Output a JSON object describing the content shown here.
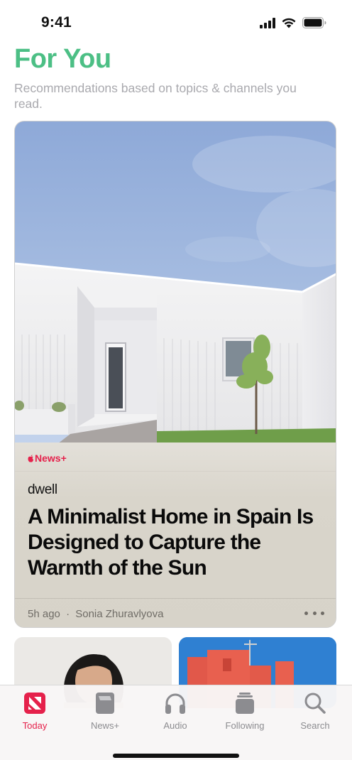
{
  "status_bar": {
    "time": "9:41",
    "icons": [
      "cellular-signal-icon",
      "wifi-icon",
      "battery-icon"
    ]
  },
  "header": {
    "title": "For You",
    "subtitle": "Recommendations based on topics & channels you read."
  },
  "feature": {
    "badge": "News+",
    "publisher": "dwell",
    "headline": "A Minimalist Home in Spain Is Designed to Capture the Warmth of the Sun",
    "time_ago": "5h ago",
    "separator": "·",
    "author": "Sonia Zhuravlyova"
  },
  "tabs": [
    {
      "label": "Today",
      "icon": "news-icon",
      "active": true
    },
    {
      "label": "News+",
      "icon": "magazine-icon",
      "active": false
    },
    {
      "label": "Audio",
      "icon": "headphones-icon",
      "active": false
    },
    {
      "label": "Following",
      "icon": "stack-icon",
      "active": false
    },
    {
      "label": "Search",
      "icon": "search-icon",
      "active": false
    }
  ],
  "colors": {
    "accent": "#4cbf85",
    "news_red": "#e5214b",
    "inactive_tab": "#8c8c90"
  }
}
